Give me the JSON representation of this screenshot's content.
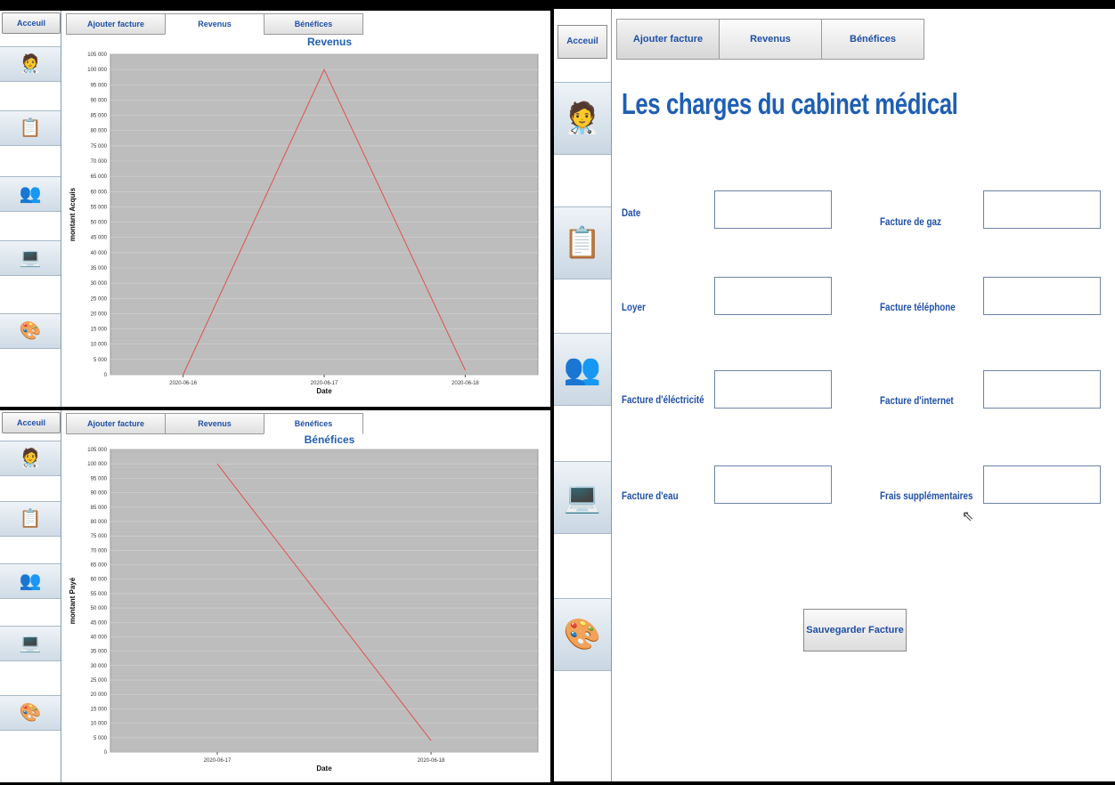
{
  "nav": {
    "home_label": "Acceuil"
  },
  "tabs": [
    "Ajouter facture",
    "Revenus",
    "Bénéfices"
  ],
  "revenus_panel": {
    "chart_data": {
      "type": "line",
      "title": "Revenus",
      "xlabel": "Date",
      "ylabel": "montant Acquis",
      "categories": [
        "2020-06-16",
        "2020-06-17",
        "2020-06-18"
      ],
      "values": [
        0,
        100000,
        1500
      ],
      "ylim": [
        0,
        105000
      ],
      "yticks": [
        "0",
        "5 000",
        "10 000",
        "15 000",
        "20 000",
        "25 000",
        "30 000",
        "35 000",
        "40 000",
        "45 000",
        "50 000",
        "55 000",
        "60 000",
        "65 000",
        "70 000",
        "75 000",
        "80 000",
        "85 000",
        "90 000",
        "95 000",
        "100 000",
        "105 000"
      ],
      "line_color": "#e05050",
      "grid": true
    }
  },
  "benefices_panel": {
    "chart_data": {
      "type": "line",
      "title": "Bénéfices",
      "xlabel": "Date",
      "ylabel": "montant Payé",
      "categories": [
        "2020-06-17",
        "2020-06-18"
      ],
      "values": [
        100000,
        4000
      ],
      "ylim": [
        0,
        105000
      ],
      "yticks": [
        "0",
        "5 000",
        "10 000",
        "15 000",
        "20 000",
        "25 000",
        "30 000",
        "35 000",
        "40 000",
        "45 000",
        "50 000",
        "55 000",
        "60 000",
        "65 000",
        "70 000",
        "75 000",
        "80 000",
        "85 000",
        "90 000",
        "95 000",
        "100 000",
        "105 000"
      ],
      "line_color": "#e05050",
      "grid": true
    }
  },
  "charges_form": {
    "title": "Les charges du cabinet médical",
    "fields_left": [
      "Date",
      "Loyer",
      "Facture d'éléctricité",
      "Facture d'eau"
    ],
    "fields_right": [
      "Facture de gaz",
      "Facture téléphone",
      "Facture d'internet",
      "Frais supplémentaires"
    ],
    "save_label": "Sauvegarder Facture"
  },
  "icons": [
    "doctor-blood-icon",
    "doctor-chart-icon",
    "doctors-icon",
    "computer-icon",
    "team-icon"
  ]
}
